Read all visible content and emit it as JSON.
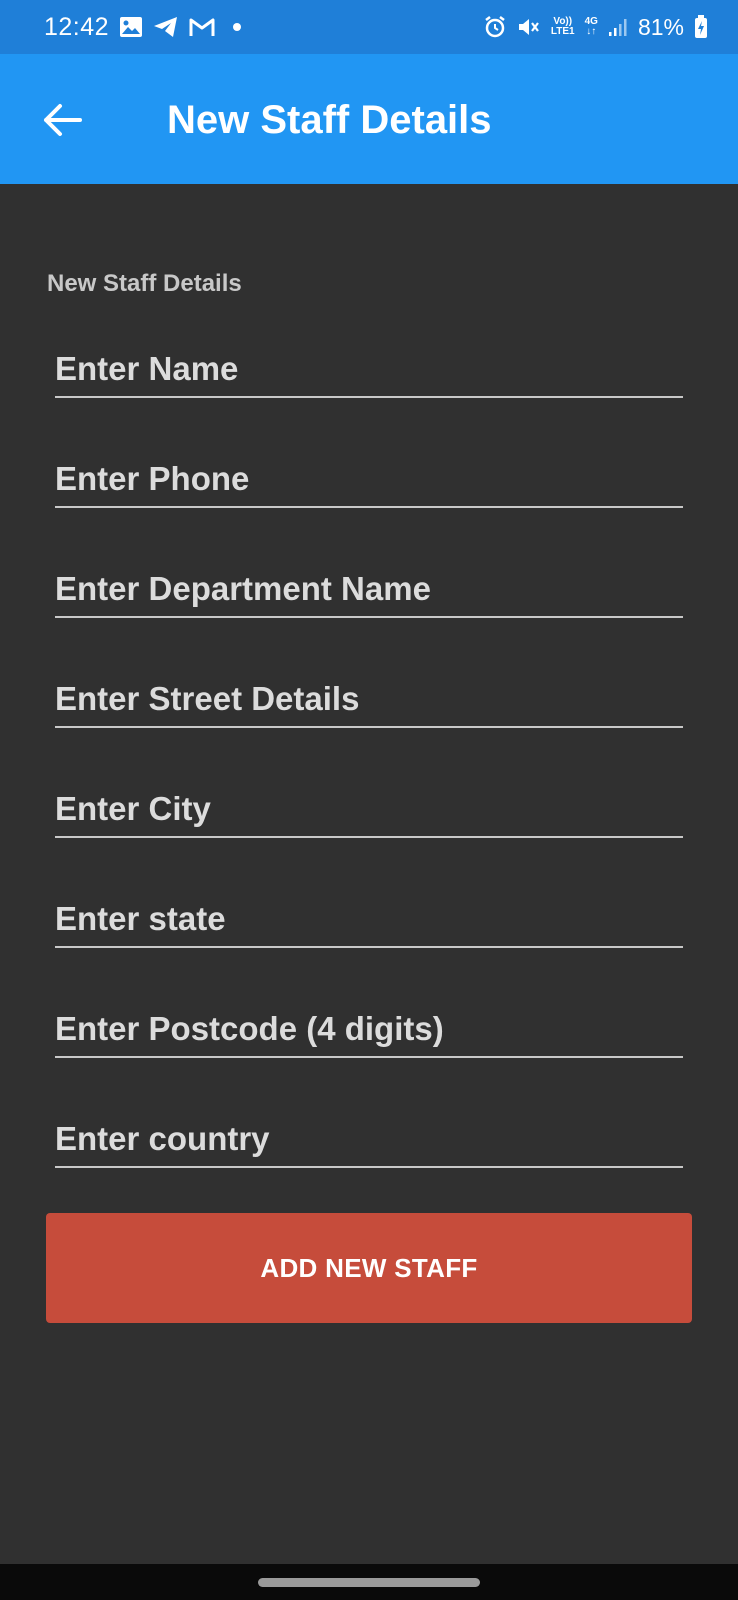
{
  "status_bar": {
    "time": "12:42",
    "left_icons": [
      "gallery-icon",
      "telegram-icon",
      "gmail-icon",
      "notification-dot"
    ],
    "right_icons": [
      "alarm-icon",
      "mute-icon",
      "volte-icon",
      "4g-icon",
      "signal-icon"
    ],
    "volte_top": "Vo))",
    "volte_bottom": "LTE1",
    "net_type": "4G",
    "battery_percent": "81%",
    "background": "#1f7fd8"
  },
  "app_bar": {
    "title": "New Staff Details",
    "back_icon": "arrow-left-icon",
    "background": "#2196f3"
  },
  "form": {
    "section_label": "New Staff Details",
    "fields": [
      {
        "name": "name-field",
        "placeholder": "Enter Name",
        "value": ""
      },
      {
        "name": "phone-field",
        "placeholder": "Enter Phone",
        "value": ""
      },
      {
        "name": "department-field",
        "placeholder": "Enter Department Name",
        "value": ""
      },
      {
        "name": "street-field",
        "placeholder": "Enter Street Details",
        "value": ""
      },
      {
        "name": "city-field",
        "placeholder": "Enter City",
        "value": ""
      },
      {
        "name": "state-field",
        "placeholder": "Enter state",
        "value": ""
      },
      {
        "name": "postcode-field",
        "placeholder": "Enter Postcode (4 digits)",
        "value": ""
      },
      {
        "name": "country-field",
        "placeholder": "Enter country",
        "value": ""
      }
    ],
    "submit_label": "ADD NEW STAFF",
    "submit_color": "#c64c3b",
    "background": "#303030"
  }
}
